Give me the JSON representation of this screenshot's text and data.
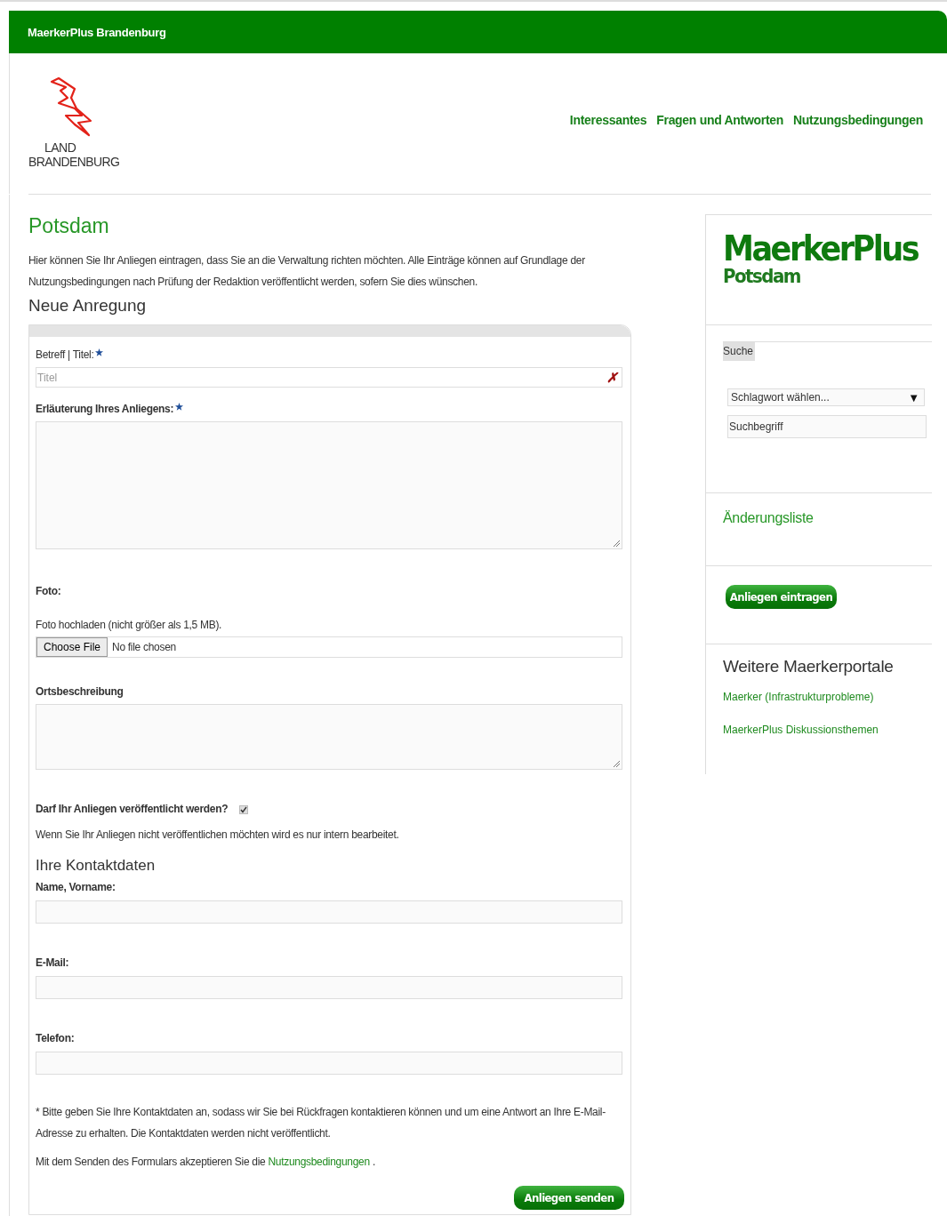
{
  "top_bar": {
    "title": "MaerkerPlus Brandenburg"
  },
  "logo": {
    "line_1": "LAND",
    "line_2": "BRANDENBURG"
  },
  "nav": [
    {
      "label": "Interessantes"
    },
    {
      "label": "Fragen und Antworten"
    },
    {
      "label": "Nutzungsbedingungen"
    }
  ],
  "main": {
    "heading": "Potsdam",
    "intro": "Hier können Sie Ihr Anliegen eintragen, dass Sie an die Verwaltung richten möchten. Alle Einträge können auf Grundlage der Nutzungsbedingungen nach Prüfung der Redaktion veröffentlicht werden, sofern Sie dies wünschen.",
    "form_title": "Neue Anregung"
  },
  "form": {
    "title_field": {
      "label": "Betreff | Titel:",
      "required": true,
      "placeholder": "Titel",
      "clear": "✗"
    },
    "description_field": {
      "label": "Erläuterung Ihres Anliegens:",
      "required": true
    },
    "photo": {
      "label": "Foto:",
      "hint": "Foto hochladen (nicht größer als 1,5 MB).",
      "button": "Choose File",
      "status": "No file chosen"
    },
    "location_field": {
      "label": "Ortsbeschreibung"
    },
    "publish": {
      "label": "Darf Ihr Anliegen veröffentlicht werden?",
      "checked": true,
      "note": "Wenn Sie Ihr Anliegen nicht veröffentlichen möchten wird es nur intern bearbeitet."
    },
    "contact": {
      "heading": "Ihre Kontaktdaten",
      "fields": [
        {
          "label": "Name, Vorname:"
        },
        {
          "label": "E-Mail:"
        },
        {
          "label": "Telefon:"
        }
      ]
    },
    "footnote": "* Bitte geben Sie Ihre Kontaktdaten an, sodass wir Sie bei Rückfragen kontaktieren können und um eine Antwort an Ihre E-Mail-Adresse zu erhalten. Die Kontaktdaten werden nicht veröffentlicht.",
    "consent": {
      "before": "Mit dem Senden des Formulars akzeptieren Sie die",
      "link": "Nutzungsbedingungen",
      "after": "."
    },
    "submit": "Anliegen senden"
  },
  "sidebar": {
    "logo": {
      "title": "MaerkerPlus",
      "subtitle": "Potsdam"
    },
    "search": {
      "label": "Suche",
      "select": "Schlagwort wählen...",
      "select_arrow": "▼",
      "placeholder": "Suchbegriff"
    },
    "change_list": "Änderungsliste",
    "add_button": "Anliegen eintragen",
    "portals": {
      "heading": "Weitere Maerkerportale",
      "links": [
        {
          "label": "Maerker (Infrastrukturprobleme)"
        },
        {
          "label": "MaerkerPlus Diskussionsthemen"
        }
      ]
    }
  }
}
